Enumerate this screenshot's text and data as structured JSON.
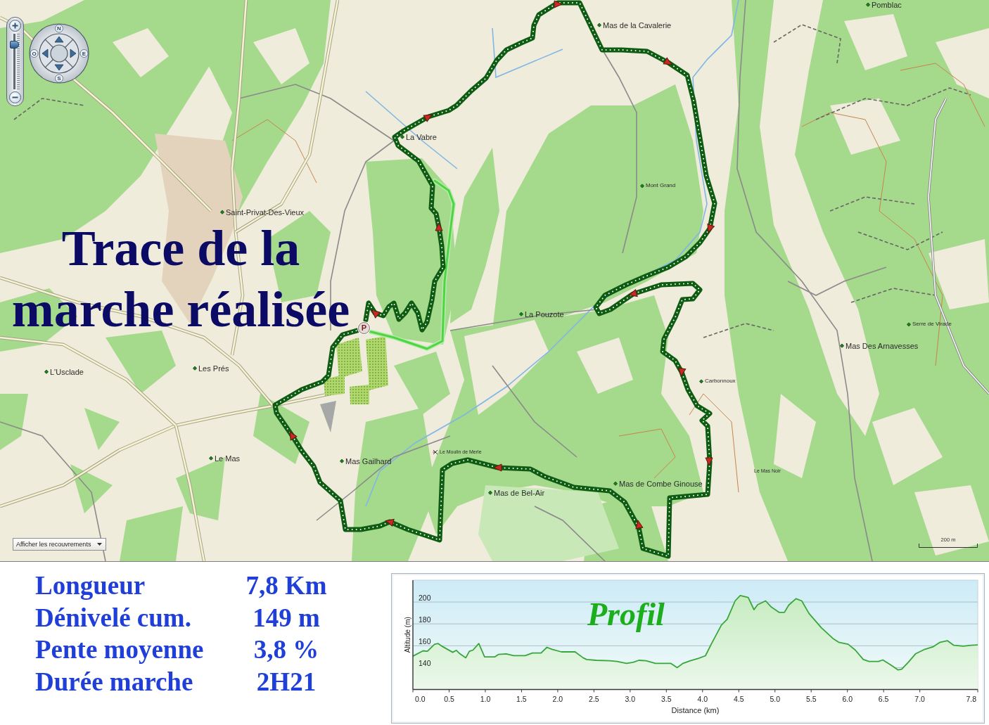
{
  "map": {
    "title": "Trace de la marche réalisée",
    "places": [
      {
        "name": "Pomblac",
        "kind": "major"
      },
      {
        "name": "Mas de la Cavalerie",
        "kind": "major"
      },
      {
        "name": "La Vabre",
        "kind": "major"
      },
      {
        "name": "Mont Grand",
        "kind": "minor"
      },
      {
        "name": "Saint-Privat-Des-Vieux",
        "kind": "major"
      },
      {
        "name": "La Pouzote",
        "kind": "major"
      },
      {
        "name": "Serre de Virade",
        "kind": "minor"
      },
      {
        "name": "Mas Des Arnavesses",
        "kind": "major"
      },
      {
        "name": "Les Prés",
        "kind": "major"
      },
      {
        "name": "L'Usclade",
        "kind": "major"
      },
      {
        "name": "Carbonnoux",
        "kind": "minor"
      },
      {
        "name": "Le Moulin de Merle",
        "kind": "mill"
      },
      {
        "name": "Le Mas",
        "kind": "major"
      },
      {
        "name": "Mas Gailhard",
        "kind": "major"
      },
      {
        "name": "Le Mas Noir",
        "kind": "plain"
      },
      {
        "name": "Mas de Combe Ginouse",
        "kind": "major"
      },
      {
        "name": "Mas de Bel-Air",
        "kind": "major"
      }
    ],
    "parking_marker": "P",
    "zoom_control": {
      "level": 0.85
    },
    "pan_control": {
      "labels": [
        "N",
        "O",
        "E",
        "S"
      ]
    },
    "overlay_dropdown": {
      "value": "Afficher les recouvrements"
    },
    "scale_bar": {
      "label": "200 m"
    }
  },
  "summary": [
    {
      "label": "Longueur",
      "value": "7,8 Km"
    },
    {
      "label": "Dénivelé cum.",
      "value": "149 m"
    },
    {
      "label": "Pente moyenne",
      "value": "3,8 %"
    },
    {
      "label": "Durée marche",
      "value": "2H21"
    }
  ],
  "profile": {
    "chart_data": {
      "type": "area",
      "title": "Profil",
      "xlabel": "Distance (km)",
      "ylabel": "Altitude (m)",
      "x": [
        0,
        0.14,
        0.2,
        0.3,
        0.35,
        0.4,
        0.55,
        0.6,
        0.65,
        0.73,
        0.78,
        0.83,
        0.91,
        0.99,
        1.13,
        1.18,
        1.29,
        1.39,
        1.55,
        1.65,
        1.77,
        1.85,
        1.92,
        2.05,
        2.24,
        2.35,
        2.4,
        2.53,
        2.72,
        2.82,
        2.95,
        3.04,
        3.12,
        3.22,
        3.35,
        3.56,
        3.65,
        3.73,
        3.83,
        3.94,
        4.04,
        4.12,
        4.26,
        4.34,
        4.45,
        4.52,
        4.63,
        4.71,
        4.76,
        4.87,
        4.95,
        5.06,
        5.13,
        5.19,
        5.29,
        5.37,
        5.47,
        5.64,
        5.8,
        5.88,
        6.01,
        6.11,
        6.22,
        6.3,
        6.43,
        6.49,
        6.59,
        6.7,
        6.75,
        6.84,
        6.94,
        7.07,
        7.18,
        7.28,
        7.38,
        7.47,
        7.6,
        7.71,
        7.8
      ],
      "values": [
        150.5,
        155.4,
        155,
        161.4,
        162,
        159.6,
        154,
        155.8,
        152.6,
        149,
        155,
        156,
        162,
        149.8,
        149.8,
        152,
        152.6,
        151,
        151,
        153.3,
        153.3,
        158.6,
        156.8,
        154.4,
        154.4,
        149,
        147.4,
        146.7,
        146.3,
        145.6,
        143.9,
        144.9,
        146.7,
        146.3,
        143.9,
        143.9,
        140,
        143.9,
        146.3,
        148.4,
        150.9,
        161.4,
        179,
        184.2,
        201,
        206,
        204.2,
        193,
        197.5,
        201,
        195.4,
        190.5,
        190.5,
        197.2,
        203,
        201,
        189.5,
        176.5,
        166.7,
        163.2,
        161.4,
        156,
        147.4,
        145.6,
        145.6,
        147,
        142.8,
        137.9,
        138.6,
        144.9,
        152.6,
        156.8,
        159,
        163.2,
        164.6,
        160.4,
        159.6,
        160.4,
        160.7
      ],
      "xlim": [
        0,
        7.8
      ],
      "ylim": [
        120,
        220
      ],
      "grid": true,
      "xticks": [
        {
          "value": 0,
          "label": "0.0"
        },
        {
          "value": 0.5,
          "label": "0.5"
        },
        {
          "value": 1,
          "label": "1.0"
        },
        {
          "value": 1.5,
          "label": "1.5"
        },
        {
          "value": 2,
          "label": "2.0"
        },
        {
          "value": 2.5,
          "label": "2.5"
        },
        {
          "value": 3,
          "label": "3.0"
        },
        {
          "value": 3.5,
          "label": "3.5"
        },
        {
          "value": 4,
          "label": "4.0"
        },
        {
          "value": 4.5,
          "label": "4.5"
        },
        {
          "value": 5,
          "label": "5.0"
        },
        {
          "value": 5.5,
          "label": "5.5"
        },
        {
          "value": 6,
          "label": "6.0"
        },
        {
          "value": 6.5,
          "label": "6.5"
        },
        {
          "value": 7,
          "label": "7.0"
        },
        {
          "value": 7.8,
          "label": "7.8"
        }
      ],
      "yticks": [
        140,
        160,
        180,
        200
      ]
    }
  }
}
